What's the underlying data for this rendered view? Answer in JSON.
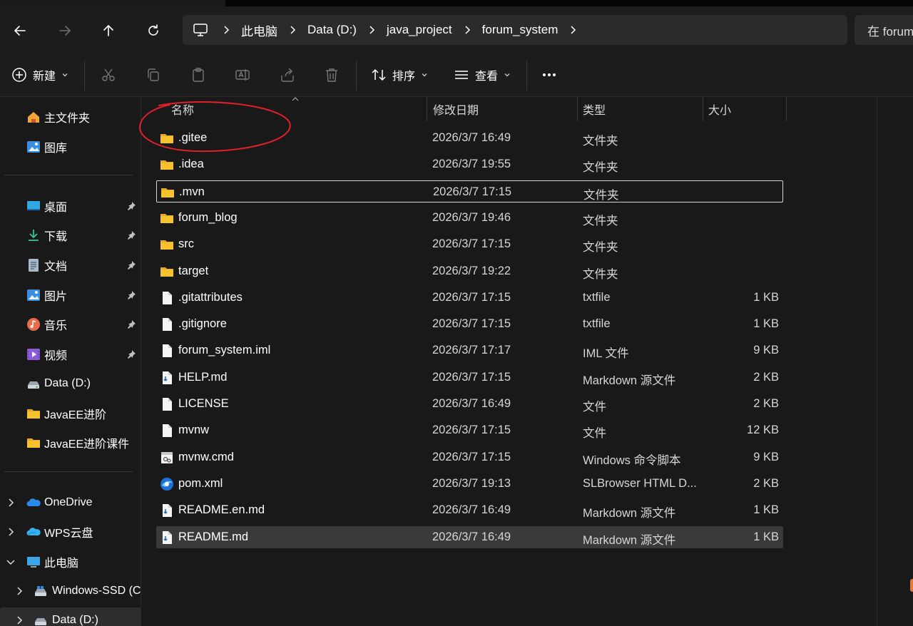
{
  "address": {
    "crumbs": [
      "此电脑",
      "Data (D:)",
      "java_project",
      "forum_system"
    ],
    "search_placeholder": "在 forum_system 中搜索"
  },
  "toolbar": {
    "new_label": "新建",
    "sort_label": "排序",
    "view_label": "查看"
  },
  "sidebar": {
    "quick": [
      {
        "label": "主文件夹",
        "icon": "home-icon"
      },
      {
        "label": "图库",
        "icon": "gallery-icon"
      }
    ],
    "pinned": [
      {
        "label": "桌面",
        "icon": "desktop-icon",
        "pinned": true
      },
      {
        "label": "下载",
        "icon": "download-icon",
        "pinned": true
      },
      {
        "label": "文档",
        "icon": "document-icon",
        "pinned": true
      },
      {
        "label": "图片",
        "icon": "pictures-icon",
        "pinned": true
      },
      {
        "label": "音乐",
        "icon": "music-icon",
        "pinned": true
      },
      {
        "label": "视频",
        "icon": "video-icon",
        "pinned": true
      },
      {
        "label": "Data (D:)",
        "icon": "drive-icon",
        "pinned": false
      },
      {
        "label": "JavaEE进阶",
        "icon": "folder-icon",
        "pinned": false
      },
      {
        "label": "JavaEE进阶课件",
        "icon": "folder-icon",
        "pinned": false
      }
    ],
    "tree": [
      {
        "label": "OneDrive",
        "icon": "onedrive-icon",
        "expander": "collapsed"
      },
      {
        "label": "WPS云盘",
        "icon": "wps-cloud-icon",
        "expander": "collapsed"
      },
      {
        "label": "此电脑",
        "icon": "this-pc-icon",
        "expander": "expanded"
      },
      {
        "label": "Windows-SSD (C:)",
        "icon": "windows-drive-icon",
        "expander": "collapsed"
      },
      {
        "label": "Data (D:)",
        "icon": "drive-icon",
        "expander": "collapsed"
      }
    ]
  },
  "columns": {
    "name": "名称",
    "date": "修改日期",
    "type": "类型",
    "size": "大小"
  },
  "files": [
    {
      "name": ".gitee",
      "date": "2026/3/7 16:49",
      "type": "文件夹",
      "size": "",
      "icon": "folder"
    },
    {
      "name": ".idea",
      "date": "2026/3/7 19:55",
      "type": "文件夹",
      "size": "",
      "icon": "folder"
    },
    {
      "name": ".mvn",
      "date": "2026/3/7 17:15",
      "type": "文件夹",
      "size": "",
      "icon": "folder",
      "state": "focus"
    },
    {
      "name": "forum_blog",
      "date": "2026/3/7 19:46",
      "type": "文件夹",
      "size": "",
      "icon": "folder"
    },
    {
      "name": "src",
      "date": "2026/3/7 17:15",
      "type": "文件夹",
      "size": "",
      "icon": "folder"
    },
    {
      "name": "target",
      "date": "2026/3/7 19:22",
      "type": "文件夹",
      "size": "",
      "icon": "folder"
    },
    {
      "name": ".gitattributes",
      "date": "2026/3/7 17:15",
      "type": "txtfile",
      "size": "1 KB",
      "icon": "file"
    },
    {
      "name": ".gitignore",
      "date": "2026/3/7 17:15",
      "type": "txtfile",
      "size": "1 KB",
      "icon": "file"
    },
    {
      "name": "forum_system.iml",
      "date": "2026/3/7 17:17",
      "type": "IML 文件",
      "size": "9 KB",
      "icon": "file"
    },
    {
      "name": "HELP.md",
      "date": "2026/3/7 17:15",
      "type": "Markdown 源文件",
      "size": "2 KB",
      "icon": "markdown"
    },
    {
      "name": "LICENSE",
      "date": "2026/3/7 16:49",
      "type": "文件",
      "size": "2 KB",
      "icon": "file"
    },
    {
      "name": "mvnw",
      "date": "2026/3/7 17:15",
      "type": "文件",
      "size": "12 KB",
      "icon": "file"
    },
    {
      "name": "mvnw.cmd",
      "date": "2026/3/7 17:15",
      "type": "Windows 命令脚本",
      "size": "9 KB",
      "icon": "cmd"
    },
    {
      "name": "pom.xml",
      "date": "2026/3/7 19:13",
      "type": "SLBrowser HTML D...",
      "size": "2 KB",
      "icon": "browser"
    },
    {
      "name": "README.en.md",
      "date": "2026/3/7 16:49",
      "type": "Markdown 源文件",
      "size": "1 KB",
      "icon": "markdown"
    },
    {
      "name": "README.md",
      "date": "2026/3/7 16:49",
      "type": "Markdown 源文件",
      "size": "1 KB",
      "icon": "markdown",
      "state": "selected"
    }
  ],
  "colors": {
    "background": "#191919",
    "folder": "#f8c22f",
    "annotation": "#e0202a",
    "selection": "#3a3a3a"
  }
}
